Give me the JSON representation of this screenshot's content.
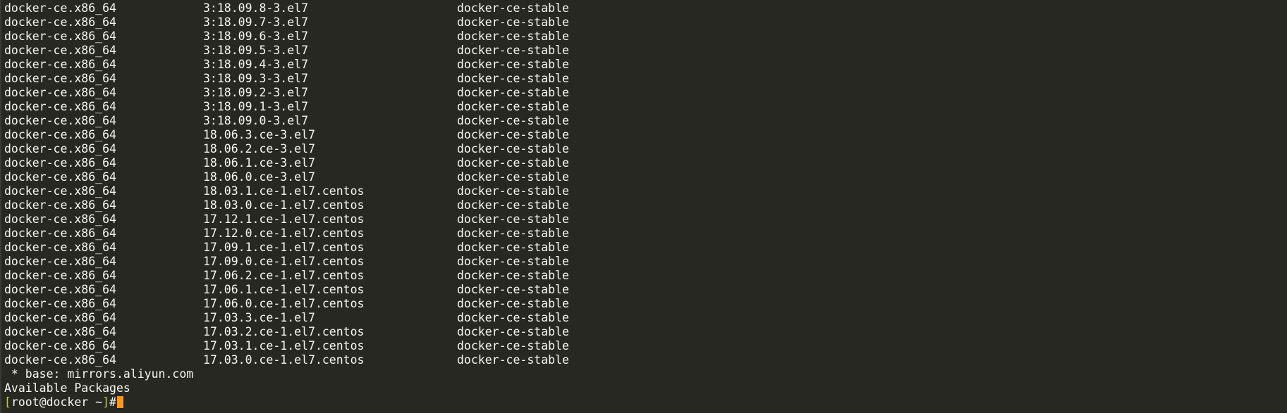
{
  "rows": [
    {
      "pkg": "docker-ce.x86_64",
      "ver": "3:18.09.8-3.el7",
      "repo": "docker-ce-stable"
    },
    {
      "pkg": "docker-ce.x86_64",
      "ver": "3:18.09.7-3.el7",
      "repo": "docker-ce-stable"
    },
    {
      "pkg": "docker-ce.x86_64",
      "ver": "3:18.09.6-3.el7",
      "repo": "docker-ce-stable"
    },
    {
      "pkg": "docker-ce.x86_64",
      "ver": "3:18.09.5-3.el7",
      "repo": "docker-ce-stable"
    },
    {
      "pkg": "docker-ce.x86_64",
      "ver": "3:18.09.4-3.el7",
      "repo": "docker-ce-stable"
    },
    {
      "pkg": "docker-ce.x86_64",
      "ver": "3:18.09.3-3.el7",
      "repo": "docker-ce-stable"
    },
    {
      "pkg": "docker-ce.x86_64",
      "ver": "3:18.09.2-3.el7",
      "repo": "docker-ce-stable"
    },
    {
      "pkg": "docker-ce.x86_64",
      "ver": "3:18.09.1-3.el7",
      "repo": "docker-ce-stable"
    },
    {
      "pkg": "docker-ce.x86_64",
      "ver": "3:18.09.0-3.el7",
      "repo": "docker-ce-stable"
    },
    {
      "pkg": "docker-ce.x86_64",
      "ver": "18.06.3.ce-3.el7",
      "repo": "docker-ce-stable"
    },
    {
      "pkg": "docker-ce.x86_64",
      "ver": "18.06.2.ce-3.el7",
      "repo": "docker-ce-stable"
    },
    {
      "pkg": "docker-ce.x86_64",
      "ver": "18.06.1.ce-3.el7",
      "repo": "docker-ce-stable"
    },
    {
      "pkg": "docker-ce.x86_64",
      "ver": "18.06.0.ce-3.el7",
      "repo": "docker-ce-stable"
    },
    {
      "pkg": "docker-ce.x86_64",
      "ver": "18.03.1.ce-1.el7.centos",
      "repo": "docker-ce-stable"
    },
    {
      "pkg": "docker-ce.x86_64",
      "ver": "18.03.0.ce-1.el7.centos",
      "repo": "docker-ce-stable"
    },
    {
      "pkg": "docker-ce.x86_64",
      "ver": "17.12.1.ce-1.el7.centos",
      "repo": "docker-ce-stable"
    },
    {
      "pkg": "docker-ce.x86_64",
      "ver": "17.12.0.ce-1.el7.centos",
      "repo": "docker-ce-stable"
    },
    {
      "pkg": "docker-ce.x86_64",
      "ver": "17.09.1.ce-1.el7.centos",
      "repo": "docker-ce-stable"
    },
    {
      "pkg": "docker-ce.x86_64",
      "ver": "17.09.0.ce-1.el7.centos",
      "repo": "docker-ce-stable"
    },
    {
      "pkg": "docker-ce.x86_64",
      "ver": "17.06.2.ce-1.el7.centos",
      "repo": "docker-ce-stable"
    },
    {
      "pkg": "docker-ce.x86_64",
      "ver": "17.06.1.ce-1.el7.centos",
      "repo": "docker-ce-stable"
    },
    {
      "pkg": "docker-ce.x86_64",
      "ver": "17.06.0.ce-1.el7.centos",
      "repo": "docker-ce-stable"
    },
    {
      "pkg": "docker-ce.x86_64",
      "ver": "17.03.3.ce-1.el7",
      "repo": "docker-ce-stable"
    },
    {
      "pkg": "docker-ce.x86_64",
      "ver": "17.03.2.ce-1.el7.centos",
      "repo": "docker-ce-stable"
    },
    {
      "pkg": "docker-ce.x86_64",
      "ver": "17.03.1.ce-1.el7.centos",
      "repo": "docker-ce-stable"
    },
    {
      "pkg": "docker-ce.x86_64",
      "ver": "17.03.0.ce-1.el7.centos",
      "repo": "docker-ce-stable"
    }
  ],
  "footer": {
    "base_line": " * base: mirrors.aliyun.com",
    "available": "Available Packages"
  },
  "prompt": {
    "open_bracket": "[",
    "user": "root",
    "at": "@",
    "host": "docker",
    "cwd": " ~",
    "close_bracket": "]",
    "symbol": "#"
  },
  "colors": {
    "background": "#272822",
    "foreground": "#f8f8f2",
    "bracket": "#c8c84a",
    "cursor": "#fd971f"
  }
}
